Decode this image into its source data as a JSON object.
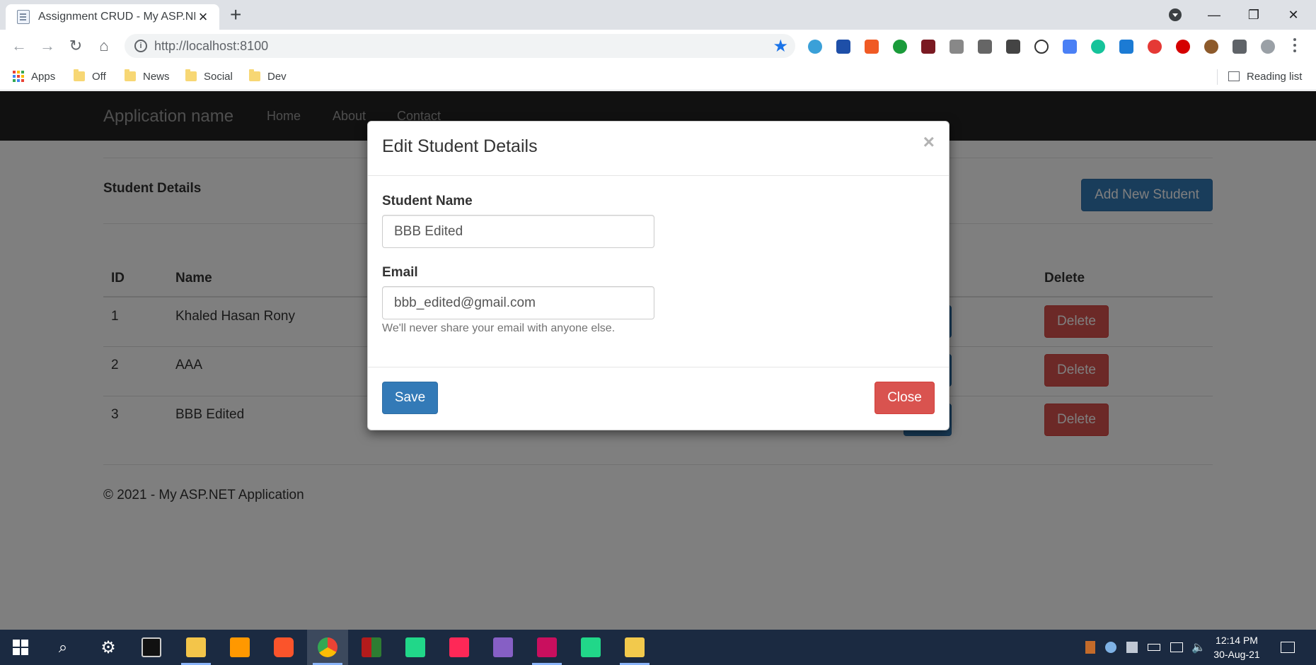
{
  "browser": {
    "tab_title": "Assignment CRUD - My ASP.NET",
    "tab_close": "×",
    "new_tab": "+",
    "url": "http://localhost:8100",
    "bookmarks": [
      {
        "label": "Apps"
      },
      {
        "label": "Off"
      },
      {
        "label": "News"
      },
      {
        "label": "Social"
      },
      {
        "label": "Dev"
      }
    ],
    "reading_list": "Reading list",
    "window_controls": {
      "minimize": "—",
      "restore": "❐",
      "close": "✕"
    }
  },
  "app": {
    "brand": "Application name",
    "nav": [
      "Home",
      "About",
      "Contact"
    ],
    "section_title": "Student Details",
    "add_button": "Add New Student",
    "table": {
      "headers": {
        "id": "ID",
        "name": "Name",
        "delete": "Delete"
      },
      "rows": [
        {
          "id": "1",
          "name": "Khaled Hasan Rony",
          "delete_label": "Delete"
        },
        {
          "id": "2",
          "name": "AAA",
          "delete_label": "Delete"
        },
        {
          "id": "3",
          "name": "BBB Edited",
          "delete_label": "Delete"
        }
      ]
    },
    "footer": "© 2021 - My ASP.NET Application"
  },
  "modal": {
    "title": "Edit Student Details",
    "close_x": "×",
    "name_label": "Student Name",
    "name_value": "BBB Edited",
    "email_label": "Email",
    "email_value": "bbb_edited@gmail.com",
    "email_help": "We'll never share your email with anyone else.",
    "save": "Save",
    "close": "Close"
  },
  "taskbar": {
    "time": "12:14 PM",
    "date": "30-Aug-21"
  },
  "colors": {
    "primary": "#337ab7",
    "danger": "#d9534f",
    "navbar": "#222222",
    "taskbar": "#1b2a41"
  }
}
